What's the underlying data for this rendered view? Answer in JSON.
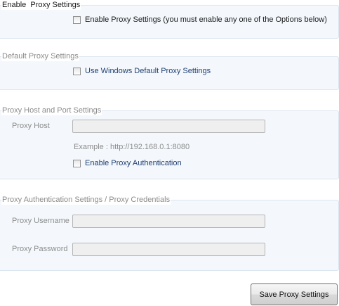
{
  "enable_section": {
    "legend": "Enable  Proxy Settings",
    "checkbox_label": "Enable Proxy Settings (you must enable any one of the Options below)",
    "checked": false
  },
  "default_section": {
    "legend": "Default Proxy Settings",
    "checkbox_label": "Use Windows Default Proxy Settings",
    "checked": false
  },
  "host_section": {
    "legend": "Proxy Host and Port Settings",
    "host_label": "Proxy Host",
    "host_value": "",
    "example": "Example : http://192.168.0.1:8080",
    "auth_checkbox_label": "Enable Proxy Authentication",
    "auth_checked": false
  },
  "auth_section": {
    "legend": "Proxy Authentication Settings / Proxy Credentials",
    "username_label": "Proxy Username",
    "username_value": "",
    "password_label": "Proxy Password",
    "password_value": ""
  },
  "footer": {
    "save_label": "Save Proxy Settings"
  }
}
